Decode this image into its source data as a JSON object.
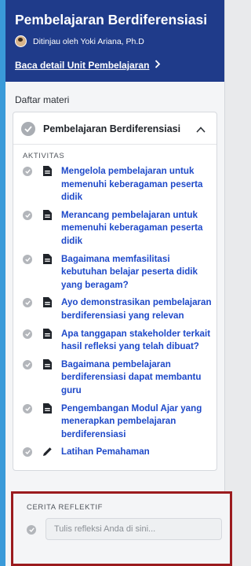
{
  "header": {
    "title": "Pembelajaran Berdiferensiasi",
    "reviewer": "Ditinjau oleh Yoki Ariana, Ph.D",
    "detail_link": "Baca detail Unit Pembelajaran",
    "bg_color": "#1f3b8a"
  },
  "materials": {
    "section_label": "Daftar materi",
    "module": {
      "title": "Pembelajaran Berdiferensiasi",
      "expanded": true,
      "activities_label": "AKTIVITAS",
      "activities": [
        {
          "icon": "document-icon",
          "title": "Mengelola pembelajaran untuk memenuhi keberagaman peserta didik"
        },
        {
          "icon": "document-icon",
          "title": "Merancang pembelajaran untuk memenuhi keberagaman peserta didik"
        },
        {
          "icon": "document-icon",
          "title": "Bagaimana memfasilitasi kebutuhan belajar peserta didik yang beragam?"
        },
        {
          "icon": "document-icon",
          "title": "Ayo demonstrasikan pembelajaran berdiferensiasi yang relevan"
        },
        {
          "icon": "document-icon",
          "title": "Apa tanggapan stakeholder terkait hasil refleksi yang telah dibuat?"
        },
        {
          "icon": "document-icon",
          "title": "Bagaimana pembelajaran berdiferensiasi dapat membantu guru"
        },
        {
          "icon": "document-icon",
          "title": "Pengembangan Modul Ajar yang menerapkan pembelajaran berdiferensiasi"
        },
        {
          "icon": "pencil-icon",
          "title": "Latihan Pemahaman"
        }
      ]
    }
  },
  "reflection": {
    "label": "CERITA REFLEKTIF",
    "placeholder": "Tulis refleksi Anda di sini..."
  },
  "colors": {
    "accent_link": "#1e49c9",
    "check_grey": "#b3b6bb",
    "highlight_border": "#9b1b1e"
  }
}
